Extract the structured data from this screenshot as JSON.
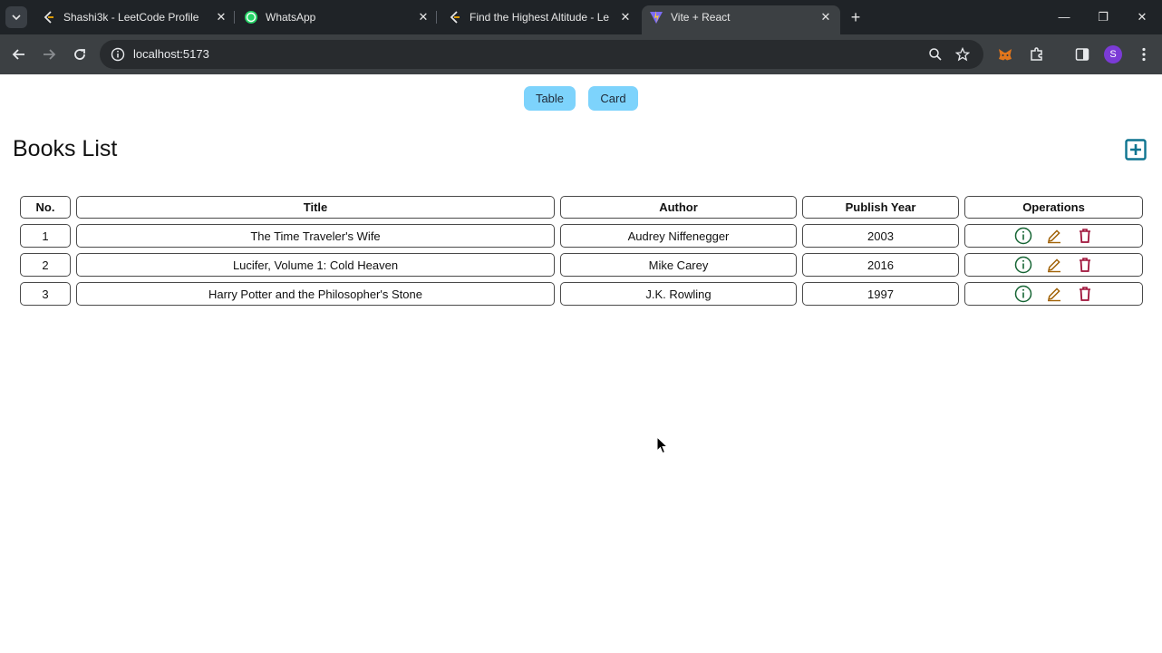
{
  "browser": {
    "tabs": [
      {
        "title": "Shashi3k - LeetCode Profile",
        "icon": "leetcode-icon"
      },
      {
        "title": "WhatsApp",
        "icon": "whatsapp-icon"
      },
      {
        "title": "Find the Highest Altitude - Leet",
        "icon": "leetcode-icon"
      },
      {
        "title": "Vite + React",
        "icon": "vite-icon",
        "active": true
      }
    ],
    "url": "localhost:5173",
    "profile_initial": "S"
  },
  "view_toggle": {
    "table_label": "Table",
    "card_label": "Card"
  },
  "page": {
    "title": "Books List"
  },
  "table": {
    "headers": [
      "No.",
      "Title",
      "Author",
      "Publish Year",
      "Operations"
    ],
    "rows": [
      {
        "no": "1",
        "title": "The Time Traveler's Wife",
        "author": "Audrey Niffenegger",
        "year": "2003"
      },
      {
        "no": "2",
        "title": "Lucifer, Volume 1: Cold Heaven",
        "author": "Mike Carey",
        "year": "2016"
      },
      {
        "no": "3",
        "title": "Harry Potter and the Philosopher's Stone",
        "author": "J.K. Rowling",
        "year": "1997"
      }
    ]
  },
  "colors": {
    "accent": "#7dd3fc",
    "add_icon": "#0e7490",
    "info_icon": "#166534",
    "edit_icon": "#a16207",
    "delete_icon": "#9f1239"
  }
}
